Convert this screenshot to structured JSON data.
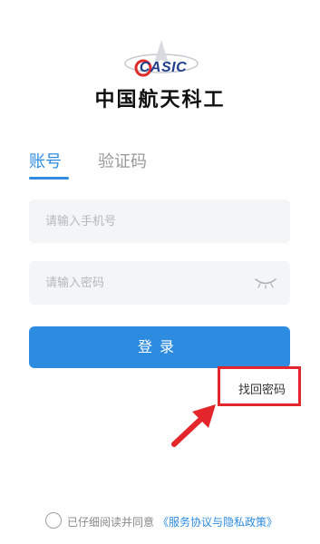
{
  "header": {
    "logo_text": "CASIC",
    "brand_name": "中国航天科工"
  },
  "tabs": [
    {
      "label": "账号",
      "active": true
    },
    {
      "label": "验证码",
      "active": false
    }
  ],
  "form": {
    "phone_placeholder": "请输入手机号",
    "password_placeholder": "请输入密码",
    "login_label": "登录",
    "forgot_label": "找回密码"
  },
  "consent": {
    "text": "已仔细阅读并同意",
    "policy_link": "《服务协议与隐私政策》",
    "checked": false
  },
  "colors": {
    "accent": "#2d8be0",
    "annotation": "#e3262c",
    "input_bg": "#f4f5f7"
  },
  "icons": {
    "logo": "casic-logo-icon",
    "password_toggle": "eye-closed-icon",
    "annotation_arrow": "arrow-icon"
  }
}
